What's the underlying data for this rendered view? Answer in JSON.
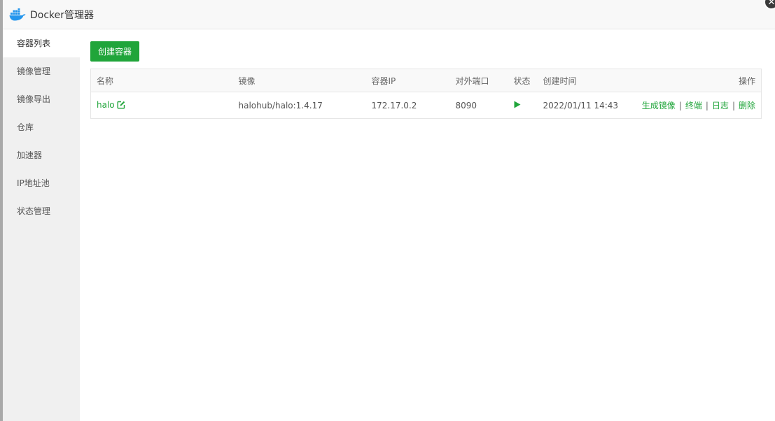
{
  "window": {
    "title": "Docker管理器",
    "close_glyph": "✕"
  },
  "sidebar": {
    "items": [
      {
        "label": "容器列表",
        "active": true
      },
      {
        "label": "镜像管理"
      },
      {
        "label": "镜像导出"
      },
      {
        "label": "仓库"
      },
      {
        "label": "加速器"
      },
      {
        "label": "IP地址池"
      },
      {
        "label": "状态管理"
      }
    ]
  },
  "toolbar": {
    "create_label": "创建容器"
  },
  "table": {
    "headers": {
      "name": "名称",
      "image": "镜像",
      "ip": "容器IP",
      "port": "对外端口",
      "status": "状态",
      "created": "创建时间",
      "ops": "操作"
    },
    "rows": [
      {
        "name": "halo",
        "image": "halohub/halo:1.4.17",
        "ip": "172.17.0.2",
        "port": "8090",
        "status_icon": "play-icon",
        "created": "2022/01/11 14:43",
        "ops": [
          "生成镜像",
          "终端",
          "日志",
          "删除"
        ]
      }
    ],
    "separator": "|"
  },
  "colors": {
    "accent": "#20a53a",
    "sidebar_bg": "#f0f0f0",
    "titlebar_bg": "#f8f8f8",
    "docker_blue": "#2496ed"
  }
}
